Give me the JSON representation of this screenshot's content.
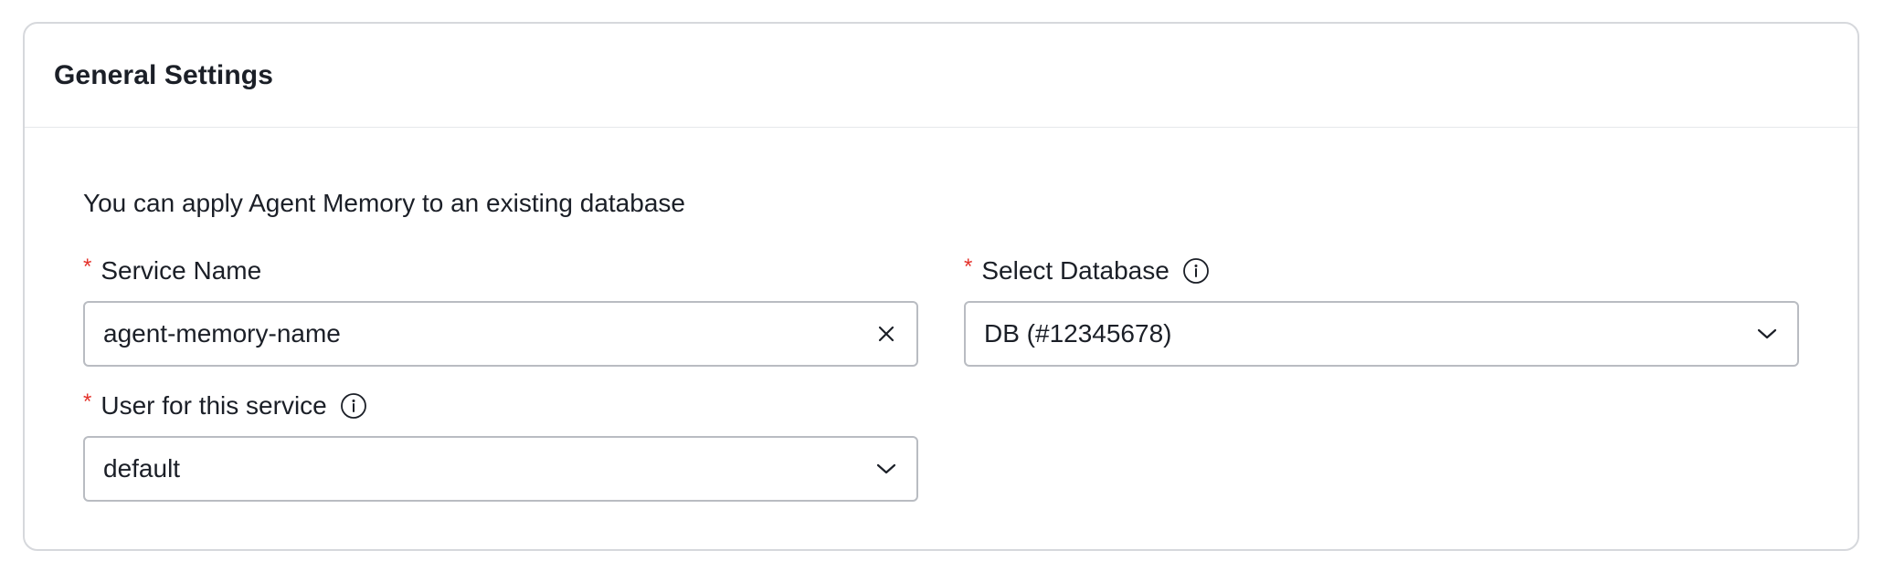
{
  "card": {
    "title": "General Settings"
  },
  "form": {
    "description": "You can apply Agent Memory to an existing database",
    "required_mark": "*",
    "service_name": {
      "label": "Service Name",
      "value": "agent-memory-name",
      "clear_icon": "close-icon"
    },
    "select_database": {
      "label": "Select Database",
      "selected": "DB (#12345678)",
      "info_icon": "info-icon",
      "dropdown_icon": "chevron-down-icon"
    },
    "user_for_service": {
      "label": "User for this service",
      "selected": "default",
      "info_icon": "info-icon",
      "dropdown_icon": "chevron-down-icon"
    }
  },
  "colors": {
    "required": "#e4322b",
    "border": "#b9bcc2",
    "card_border": "#d6d8dc",
    "text": "#1b1f27"
  }
}
